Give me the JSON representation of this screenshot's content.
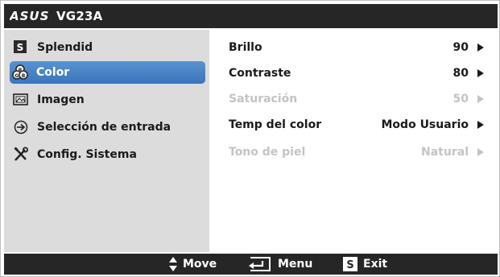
{
  "header": {
    "brand": "ASUS",
    "model": "VG23A"
  },
  "sidebar": {
    "items": [
      {
        "label": "Splendid",
        "icon": "splendid-s-icon",
        "selected": false
      },
      {
        "label": "Color",
        "icon": "color-circles-icon",
        "selected": true
      },
      {
        "label": "Imagen",
        "icon": "image-icon",
        "selected": false
      },
      {
        "label": "Selección de entrada",
        "icon": "input-select-icon",
        "selected": false
      },
      {
        "label": "Config. Sistema",
        "icon": "tools-icon",
        "selected": false
      }
    ]
  },
  "settings": [
    {
      "label": "Brillo",
      "value": "90",
      "enabled": true
    },
    {
      "label": "Contraste",
      "value": "80",
      "enabled": true
    },
    {
      "label": "Saturación",
      "value": "50",
      "enabled": false
    },
    {
      "label": "Temp del color",
      "value": "Modo Usuario",
      "enabled": true
    },
    {
      "label": "Tono de piel",
      "value": "Natural",
      "enabled": false
    }
  ],
  "footer": {
    "move": "Move",
    "menu": "Menu",
    "exit": "Exit",
    "exit_key": "S"
  },
  "colors": {
    "bar": "#262626",
    "sidebar_bg": "#dcdcdc",
    "selected": "#4a85c6",
    "disabled_text": "#c4c4c4"
  }
}
